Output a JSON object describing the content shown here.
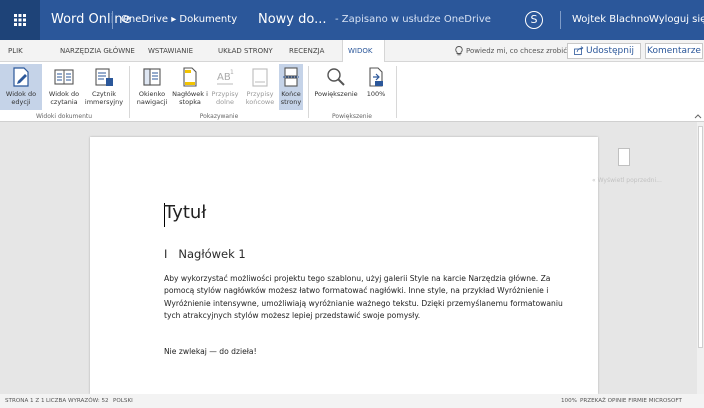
{
  "topbar": {
    "app_name": "Word Online",
    "breadcrumb": "OneDrive ▸ Dokumenty",
    "doc_name": "Nowy do...",
    "save_status": "-  Zapisano w usłudze OneDrive",
    "skype_icon": "S",
    "user_name": "Wojtek Blachno",
    "logout": "Wyloguj się"
  },
  "tabs": [
    "PLIK",
    "NARZĘDZIA GŁÓWNE",
    "WSTAWIANIE",
    "UKŁAD STRONY",
    "RECENZJA",
    "WIDOK"
  ],
  "tell_me": "Powiedz mi, co chcesz zrobić",
  "share_label": "Udostępnij",
  "comments_label": "Komentarze",
  "ribbon": {
    "views": [
      {
        "l1": "Widok do",
        "l2": "edycji"
      },
      {
        "l1": "Widok do",
        "l2": "czytania"
      },
      {
        "l1": "Czytnik",
        "l2": "immersyjny"
      }
    ],
    "show": [
      {
        "l1": "Okienko",
        "l2": "nawigacji"
      },
      {
        "l1": "Nagłówek i",
        "l2": "stopka"
      },
      {
        "l1": "Przypisy",
        "l2": "dolne"
      },
      {
        "l1": "Przypisy",
        "l2": "końcowe"
      },
      {
        "l1": "Końce",
        "l2": "strony"
      }
    ],
    "zoom": [
      {
        "l1": "Powiększenie",
        "l2": ""
      },
      {
        "l1": "100%",
        "l2": ""
      }
    ],
    "groups": [
      "Widoki dokumentu",
      "Pokazywanie",
      "Powiększenie"
    ]
  },
  "document": {
    "title": "Tytuł",
    "heading": "Nagłówek 1",
    "heading_number": "I",
    "paragraph": "Aby wykorzystać możliwości projektu tego szablonu, użyj galerii Style na karcie Narzędzia główne. Za pomocą stylów nagłówków możesz łatwo formatować nagłówki. Inne style, na przykład Wyróżnienie i Wyróżnienie intensywne, umożliwiają wyróżnianie ważnego tekstu. Dzięki przemyślanemu formatowaniu tych atrakcyjnych stylów możesz lepiej przedstawić swoje pomysły.",
    "paragraph2": "Nie zwlekaj — do dzieła!"
  },
  "margin": {
    "prev_comment": "«   Wyświetl poprzedni..."
  },
  "status": {
    "page": "STRONA 1 Z 1",
    "words": "LICZBA WYRAZÓW: 52",
    "lang": "POLSKI",
    "zoom": "100%",
    "feedback": "PRZEKAŻ OPINIE FIRMIE MICROSOFT"
  },
  "colors": {
    "brand": "#2b579a",
    "selected": "#c5d3e8"
  }
}
